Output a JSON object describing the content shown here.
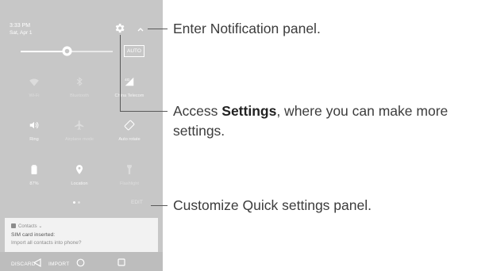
{
  "status_bar": {
    "time": "3:33 PM",
    "date": "Sat, Apr 1"
  },
  "brightness": {
    "level": 0.5,
    "auto_label": "AUTO"
  },
  "tiles": [
    {
      "label": "Wi-Fi",
      "icon": "wifi-icon",
      "active": false
    },
    {
      "label": "Bluetooth",
      "icon": "bluetooth-icon",
      "active": false
    },
    {
      "label": "China Telecom",
      "icon": "mobile-signal-icon",
      "active": true
    },
    {
      "label": "Ring",
      "icon": "volume-icon",
      "active": true
    },
    {
      "label": "Airplane mode",
      "icon": "airplane-icon",
      "active": false
    },
    {
      "label": "Auto rotate",
      "icon": "rotate-icon",
      "active": true
    },
    {
      "label": "87%",
      "icon": "battery-icon",
      "active": true
    },
    {
      "label": "Location",
      "icon": "location-icon",
      "active": true
    },
    {
      "label": "Flashlight",
      "icon": "flashlight-icon",
      "active": false
    }
  ],
  "pager": {
    "pages": 2,
    "current": 1
  },
  "edit_label": "EDIT",
  "notification": {
    "app": "Contacts",
    "title": "SIM card inserted:",
    "body": "Import all contacts into phone?",
    "actions": [
      "DISCARD",
      "IMPORT"
    ]
  },
  "callouts": {
    "notification": {
      "text": "Enter Notification panel."
    },
    "settings": {
      "prefix": "Access ",
      "bold": "Settings",
      "suffix": ", where you can make more",
      "line2": "settings."
    },
    "quick": {
      "text": "Customize Quick settings panel."
    }
  },
  "colors": {
    "panel": "#c7c7c7",
    "notification": "#f2f2f2",
    "leader": "#5a5a5a",
    "text": "#3c3c3c"
  }
}
